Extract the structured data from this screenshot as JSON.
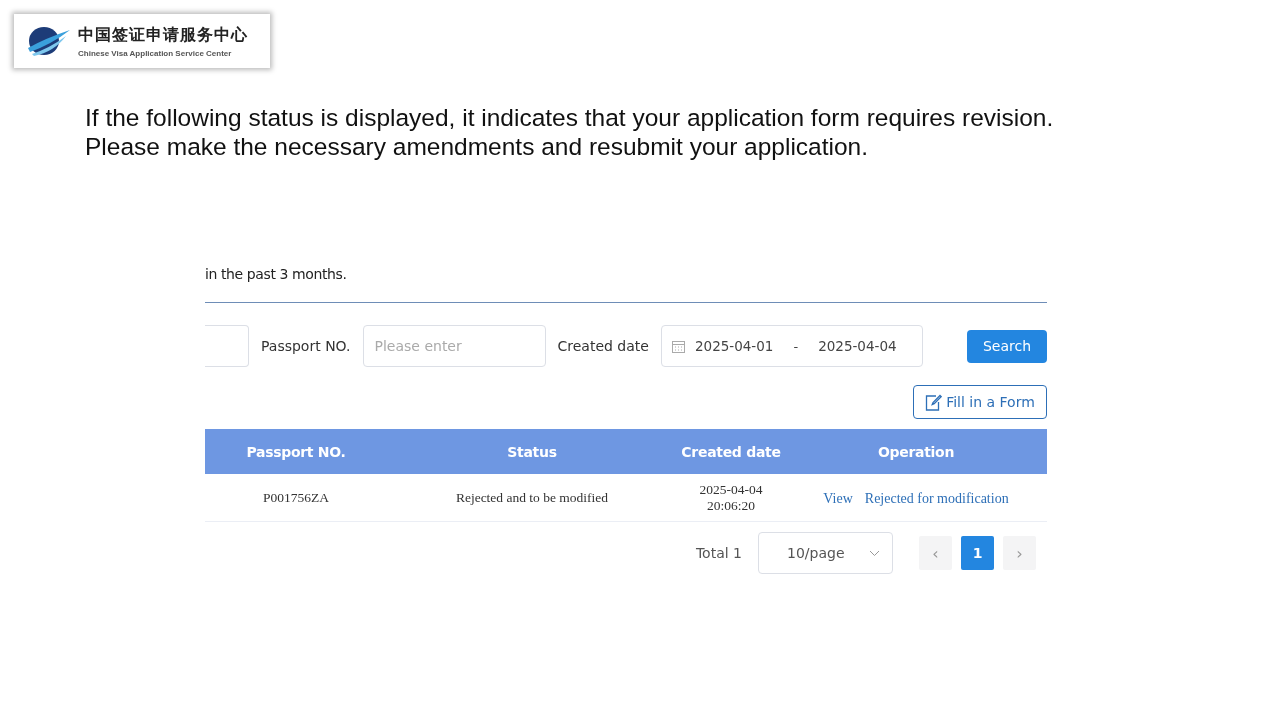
{
  "logo": {
    "title_zh": "中国签证申请服务中心",
    "title_en": "Chinese Visa Application Service Center"
  },
  "instruction": [
    "If the following status is displayed, it indicates that your application form requires revision.",
    "Please make the necessary amendments and resubmit your application."
  ],
  "screenshot": {
    "notice": "in the past 3 months.",
    "filters": [
      {
        "kind": "field"
      },
      {
        "kind": "label",
        "text": "Passport NO."
      },
      {
        "kind": "field",
        "placeholder": "Please enter"
      },
      {
        "kind": "label",
        "text": "Created date"
      },
      {
        "kind": "daterange",
        "start": "2025-04-01",
        "separator": "-",
        "end": "2025-04-04"
      }
    ],
    "search_button": "Search",
    "fill_form_button": "Fill in a Form",
    "table": {
      "columns": [
        "Passport NO.",
        "Status",
        "Created date",
        "Operation"
      ],
      "rows": [
        {
          "passport": "P001756ZA",
          "status": "Rejected and to be modified",
          "created": "2025-04-04 20:06:20",
          "actions": [
            "View",
            "Rejected for modification"
          ]
        }
      ]
    },
    "pagination": {
      "total": "Total 1",
      "page_size": "10/page",
      "prev": "‹",
      "next": "›",
      "pages": [
        {
          "label": "1",
          "selected": true
        }
      ]
    }
  }
}
